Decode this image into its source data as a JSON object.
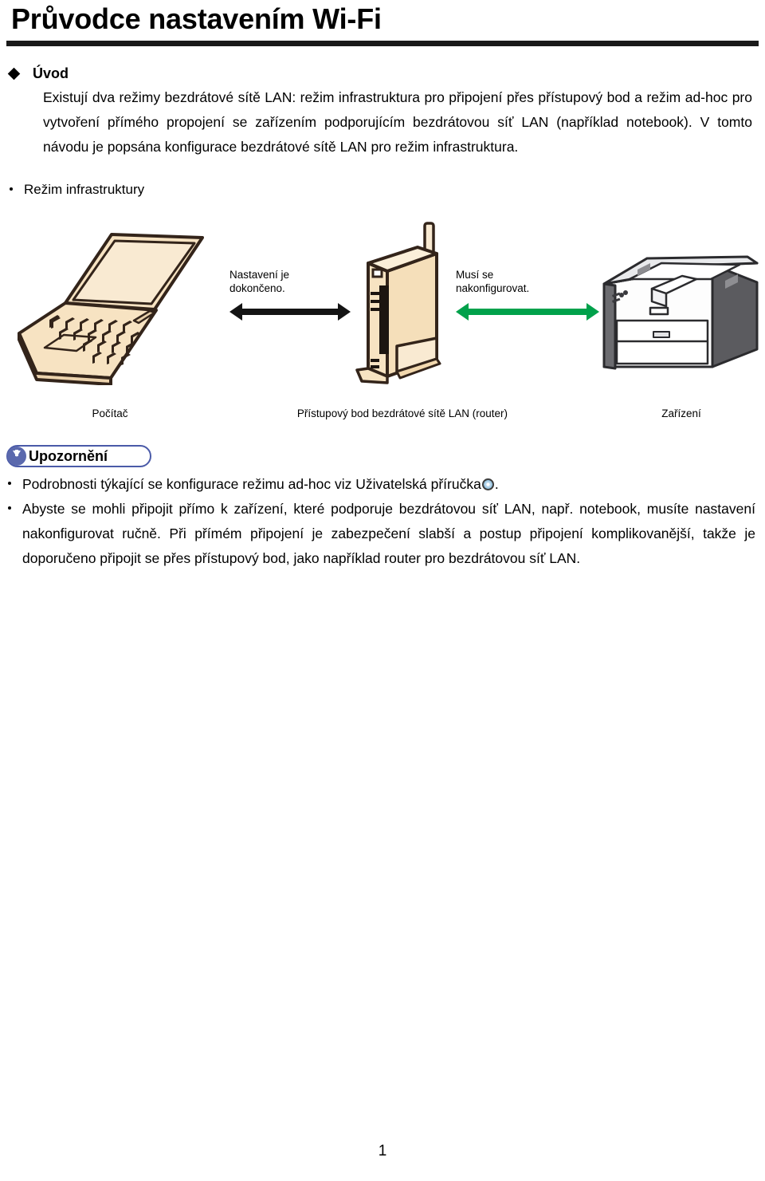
{
  "document": {
    "title": "Průvodce nastavením Wi-Fi",
    "page_number": "1"
  },
  "intro_section": {
    "heading": "Úvod",
    "bullet_glyph": "diamond",
    "paragraph_line1": "Existují dva režimy bezdrátové sítě LAN: režim infrastruktura pro připojení přes přístupový bod a režim",
    "paragraph_line2": "ad-hoc pro vytvoření přímého propojení se zařízením podporujícím bezdrátovou síť LAN (například",
    "paragraph_line3": "notebook). V tomto návodu je popsána konfigurace bezdrátové sítě LAN pro režim infrastruktura."
  },
  "figure": {
    "subheading": "Režim infrastruktury",
    "left_arrow": {
      "label_line1": "Nastavení je",
      "label_line2": "dokončeno.",
      "color": "#141414",
      "icon": "double-arrow-horizontal"
    },
    "right_arrow": {
      "label_line1": "Musí se",
      "label_line2": "nakonfigurovat.",
      "color": "#00a14b",
      "icon": "double-arrow-horizontal"
    },
    "captions": {
      "computer": "Počítač",
      "router": "Přístupový bod bezdrátové sítě LAN (router)",
      "device": "Zařízení"
    },
    "illustration_colors": {
      "device_fill": "#f7e3c2",
      "outline": "#3a2a18",
      "printer_body": "#ffffff",
      "printer_shade": "#5b5b5f"
    }
  },
  "notice": {
    "badge_label": "Upozornění",
    "badge_icon": "down-arrow-circle-icon",
    "badge_border_color": "#4a5aa8",
    "badge_icon_color": "#5b69ad",
    "items": [
      {
        "text_before_icon": "Podrobnosti týkající se konfigurace režimu ad-hoc viz Uživatelská příručka",
        "inline_icon": "cd-disc-icon",
        "text_after_icon": "."
      },
      {
        "line1": "Abyste se mohli připojit přímo k zařízení, které podporuje bezdrátovou síť LAN, např. notebook,",
        "line2": "musíte nastavení nakonfigurovat ručně. Při přímém připojení je zabezpečení slabší a postup připojení",
        "line3": "komplikovanější, takže je doporučeno připojit se přes přístupový bod, jako například router pro",
        "line4": "bezdrátovou síť LAN."
      }
    ]
  }
}
